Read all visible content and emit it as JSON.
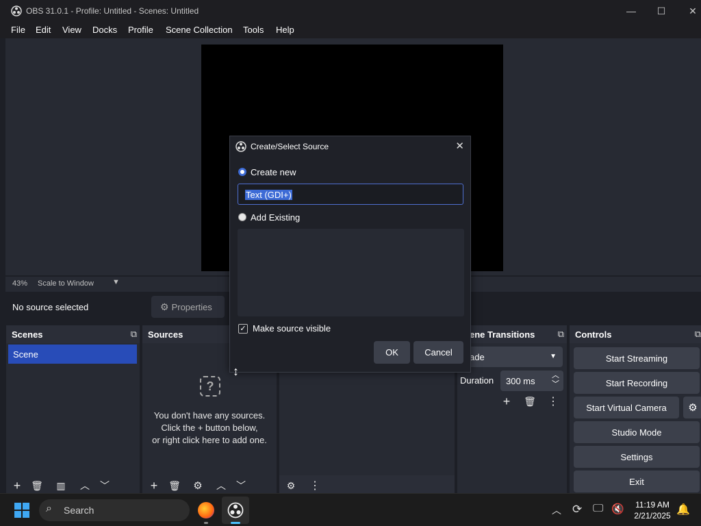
{
  "window": {
    "title": "OBS 31.0.1 - Profile: Untitled - Scenes: Untitled",
    "minimize": "—",
    "maximize": "☐",
    "close": "✕"
  },
  "menu": [
    "File",
    "Edit",
    "View",
    "Docks",
    "Profile",
    "Scene Collection",
    "Tools",
    "Help"
  ],
  "preview": {
    "zoom": "43%",
    "scale_mode": "Scale to Window"
  },
  "status": {
    "no_source": "No source selected",
    "properties_label": "Properties"
  },
  "scenes": {
    "header": "Scenes",
    "items": [
      "Scene"
    ]
  },
  "sources": {
    "header": "Sources",
    "empty_line1": "You don't have any sources.",
    "empty_line2": "Click the + button below,",
    "empty_line3": "or right click here to add one."
  },
  "transitions": {
    "header": "ene Transitions",
    "selected": "ade",
    "duration_label": "Duration",
    "duration_value": "300 ms"
  },
  "controls": {
    "header": "Controls",
    "buttons": [
      "Start Streaming",
      "Start Recording",
      "Start Virtual Camera",
      "Studio Mode",
      "Settings",
      "Exit"
    ]
  },
  "dialog": {
    "title": "Create/Select Source",
    "create_new_label": "Create new",
    "name_value": "Text (GDI+)",
    "add_existing_label": "Add Existing",
    "visible_label": "Make source visible",
    "visible_checked": "✓",
    "ok_label": "OK",
    "cancel_label": "Cancel"
  },
  "taskbar": {
    "search_label": "Search",
    "time": "11:19 AM",
    "date": "2/21/2025"
  },
  "colors": {
    "accent": "#3d6bd6",
    "background": "#1d1f26",
    "panel": "#272a33",
    "button": "#3c404b"
  }
}
